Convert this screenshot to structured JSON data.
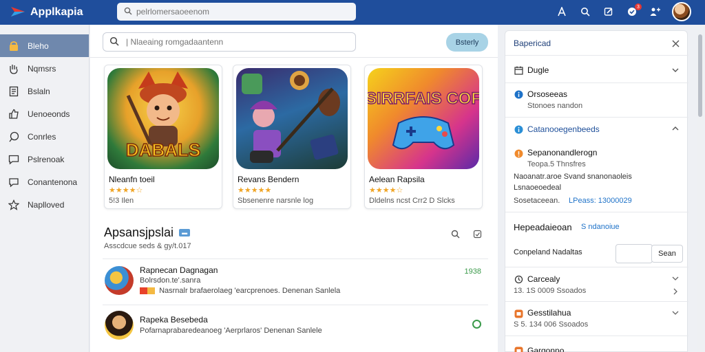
{
  "header": {
    "app_name": "Applkapia",
    "search_placeholder": "pelrlomersaoeenom",
    "notification_count": "3"
  },
  "sidebar": {
    "items": [
      {
        "label": "Bleho",
        "icon": "home-icon",
        "active": true
      },
      {
        "label": "Nqmsrs",
        "icon": "hand-icon",
        "active": false
      },
      {
        "label": "Bslaln",
        "icon": "document-icon",
        "active": false
      },
      {
        "label": "Uenoeonds",
        "icon": "thumbs-up-icon",
        "active": false
      },
      {
        "label": "Conrles",
        "icon": "chat-icon",
        "active": false
      },
      {
        "label": "Pslrenoak",
        "icon": "message-icon",
        "active": false
      },
      {
        "label": "Conantenona",
        "icon": "comment-icon",
        "active": false
      },
      {
        "label": "Naplloved",
        "icon": "star-icon",
        "active": false
      }
    ]
  },
  "main": {
    "search_placeholder": "| Nlaeaing romgadaantenn",
    "button_label": "Bsterly",
    "cards": [
      {
        "title": "Nleanfn toeil",
        "stars": "★★★★☆",
        "meta": "5!3 Ilen",
        "art_text": "DABALS"
      },
      {
        "title": "Revans Bendern",
        "stars": "★★★★★",
        "meta": "Sbsenenre narsnle log",
        "art_text": ""
      },
      {
        "title": "Aelean Rapsila",
        "stars": "★★★★☆",
        "meta": "Dldelns ncst Crr2 D Slcks",
        "art_text": "SIRRFAIS COF"
      }
    ],
    "section": {
      "title": "Apsansjpslai",
      "tag": "▬",
      "subtitle": "Asscdcue seds & gy/t.017"
    },
    "rows": [
      {
        "title": "Rapnecan Dagnagan",
        "sub": "Bolrsdon.te'.sanra",
        "desc": "Nasrnalr brafaerolaeg 'earcprenoes. Denenan Sanlela",
        "num": "1938"
      },
      {
        "title": "Rapeka Besebeda",
        "sub": "",
        "desc": "Pofarnaprabaredeanoeg 'Aerprlaros' Denenan Sanlele",
        "num": ""
      }
    ]
  },
  "panel": {
    "header_title": "Bapericad",
    "rows": [
      {
        "text": "Dugle",
        "sub": "",
        "icon": "calendar-icon"
      },
      {
        "text": "Orsoseeas",
        "sub": "Stonoes nandon",
        "icon": "info-icon"
      },
      {
        "text": "Catanooegenbeeds",
        "sub": "",
        "icon": "info-icon"
      },
      {
        "text": "Sepanonandlerogn",
        "sub": "Teopa.5 Thnsfres",
        "icon": "warning-icon"
      }
    ],
    "info_line1": "Naoanatr.aroe Svand snanonaoleis",
    "info_line2": "Lsnaoeoedeal",
    "info_line3_a": "Sosetaceean.",
    "info_line3_b": "LPeass: 13000029",
    "section_title": "Hepeadaieoan",
    "section_link": "S ndanoiue",
    "input_label": "Conpeland Nadaltas",
    "input_button": "Sean",
    "items": [
      {
        "text": "Carcealy",
        "sub": "13. 1S 0009 Ssoados",
        "icon": "refresh-icon"
      },
      {
        "text": "Gesstilahua",
        "sub": "S 5. 134 006 Ssoados",
        "icon": "orange-badge-icon"
      },
      {
        "text": "Gargonno",
        "sub": "",
        "icon": "orange-badge-icon"
      }
    ]
  },
  "colors": {
    "topbar": "#1f4e9c",
    "sidebar_active": "#6f88ad",
    "accent_button": "#a8d3e6",
    "star": "#f0a526",
    "link": "#1e72c8"
  }
}
